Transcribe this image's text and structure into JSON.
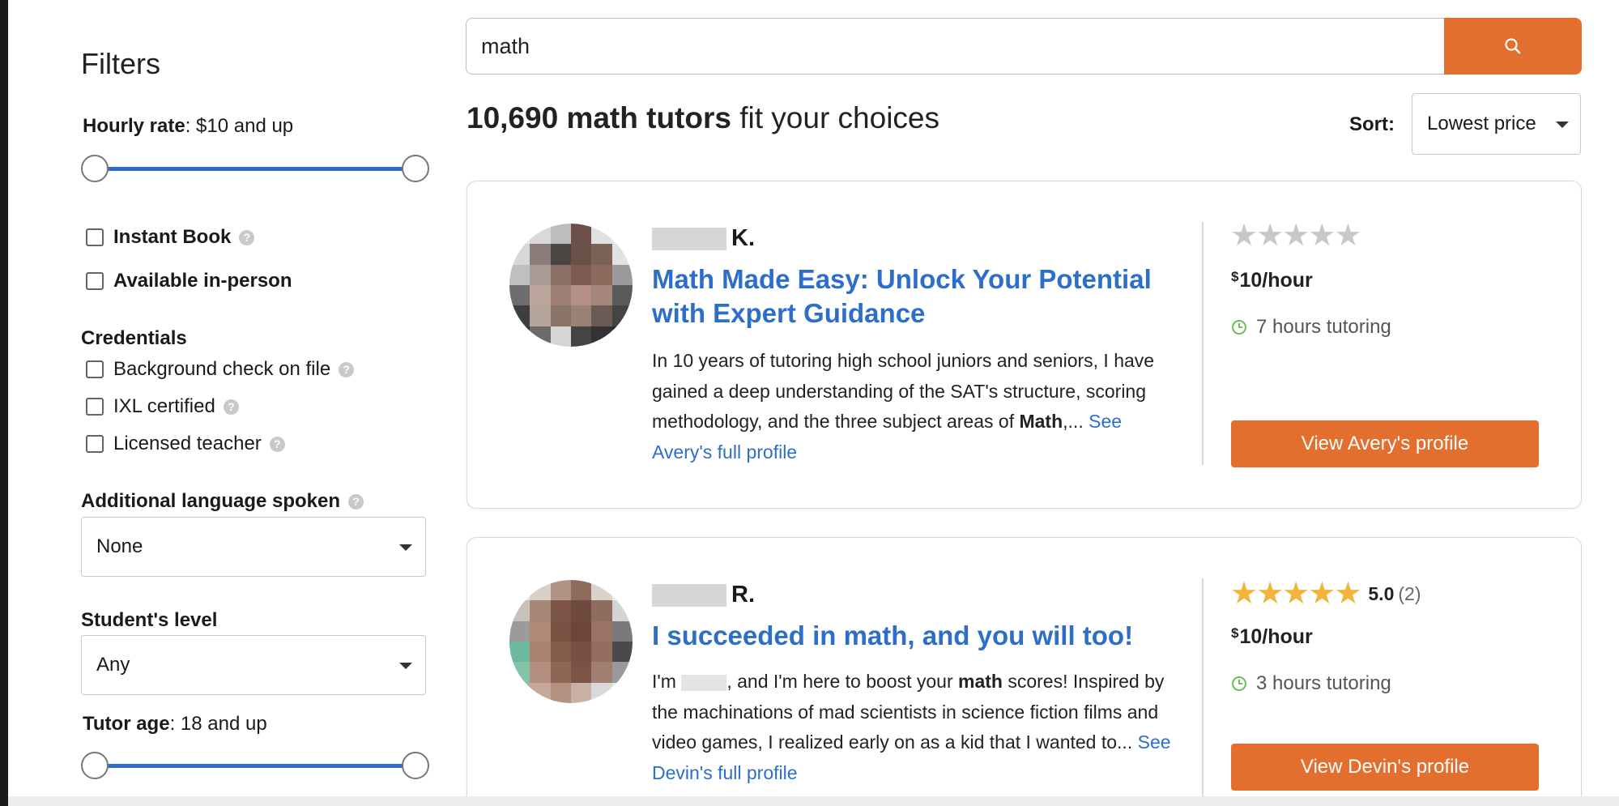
{
  "filters": {
    "title": "Filters",
    "hourly_rate": {
      "label": "Hourly rate",
      "value": ": $10 and up"
    },
    "options": [
      {
        "label": "Instant Book",
        "checked": false,
        "bold": true,
        "help": true
      },
      {
        "label": "Available in-person",
        "checked": false,
        "bold": true,
        "help": false
      }
    ],
    "credentials": {
      "title": "Credentials",
      "items": [
        {
          "label": "Background check on file",
          "checked": false
        },
        {
          "label": "IXL certified",
          "checked": false
        },
        {
          "label": "Licensed teacher",
          "checked": false
        }
      ]
    },
    "language": {
      "label": "Additional language spoken",
      "selected": "None"
    },
    "student_level": {
      "label": "Student's level",
      "selected": "Any"
    },
    "tutor_age": {
      "label": "Tutor age",
      "value": ": 18 and up"
    },
    "help_glyph": "?"
  },
  "search": {
    "value": "math",
    "button_icon": "search-icon"
  },
  "results": {
    "count": "10,690 math tutors",
    "suffix": " fit your choices",
    "sort_label": "Sort:",
    "sort_selected": "Lowest price"
  },
  "tutors": [
    {
      "initial": "K.",
      "headline": "Math Made Easy: Unlock Your Potential with Expert Guidance",
      "bio_text": "In 10 years of tutoring high school juniors and seniors, I have gained a deep understanding of the SAT's structure, scoring methodology, and the three subject areas of ",
      "bio_bold": "Math",
      "bio_tail": ",... ",
      "profile_link": "See Avery's full profile",
      "stars": 0,
      "rating": "",
      "rating_count": "",
      "price_symbol": "$",
      "price_amount": "10",
      "price_unit": "/hour",
      "hours": "7 hours tutoring",
      "button": "View Avery's profile"
    },
    {
      "initial": "R.",
      "headline": "I succeeded in math, and you will too!",
      "bio_intro": "I'm ",
      "bio_text": ", and I'm here to boost your ",
      "bio_bold": "math",
      "bio_tail": " scores! Inspired by the machinations of mad scientists in science fiction films and video games, I realized early on as a kid that I wanted to... ",
      "profile_link": "See Devin's full profile",
      "stars": 5,
      "rating": "5.0",
      "rating_count": "(2)",
      "price_symbol": "$",
      "price_amount": "10",
      "price_unit": "/hour",
      "hours": "3 hours tutoring",
      "button": "View Devin's profile"
    }
  ],
  "colors": {
    "accent": "#e36f2f",
    "link": "#2d6ec8",
    "slider": "#2f6cc9",
    "star": "#f2b53a",
    "clock": "#6bbf59"
  }
}
